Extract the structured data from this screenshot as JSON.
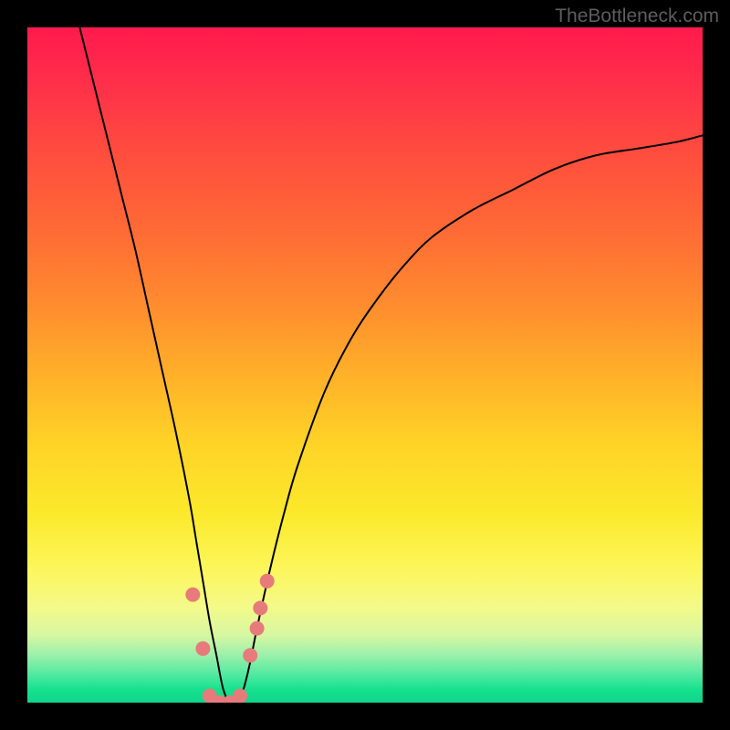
{
  "attribution": "TheBottleneck.com",
  "colors": {
    "top": "#ff1a4d",
    "mid": "#ffd427",
    "bottom": "#0fd58a",
    "marker": "#e77b7b",
    "curve": "#000000",
    "frame": "#000000"
  },
  "chart_data": {
    "type": "line",
    "title": "",
    "xlabel": "",
    "ylabel": "",
    "xlim": [
      0,
      100
    ],
    "ylim": [
      0,
      100
    ],
    "x": [
      8,
      10,
      12,
      14,
      16,
      18,
      20,
      22,
      24,
      25,
      26,
      27,
      28,
      29,
      30,
      31,
      32,
      33,
      34,
      36,
      38,
      40,
      44,
      48,
      52,
      56,
      60,
      66,
      72,
      78,
      84,
      90,
      96,
      100
    ],
    "y": [
      99,
      91,
      83,
      75,
      67,
      58,
      49,
      40,
      30,
      24,
      18,
      12,
      7,
      2,
      0,
      0,
      2,
      6,
      11,
      20,
      28,
      35,
      46,
      54,
      60,
      65,
      69,
      73,
      76,
      79,
      81,
      82,
      83,
      84
    ],
    "markers": {
      "x": [
        24.5,
        26.0,
        27.0,
        28.5,
        30.0,
        31.5,
        33.0,
        34.0,
        34.5,
        35.5
      ],
      "y": [
        16,
        8,
        1,
        0,
        0,
        1,
        7,
        11,
        14,
        18
      ]
    },
    "notes": "V-shaped bottleneck curve; steep descent from upper-left to minimum near x≈30, asymmetric rise toward upper-right. Background gradient encodes severity (red high, green low). Salmon markers cluster near the trough."
  }
}
